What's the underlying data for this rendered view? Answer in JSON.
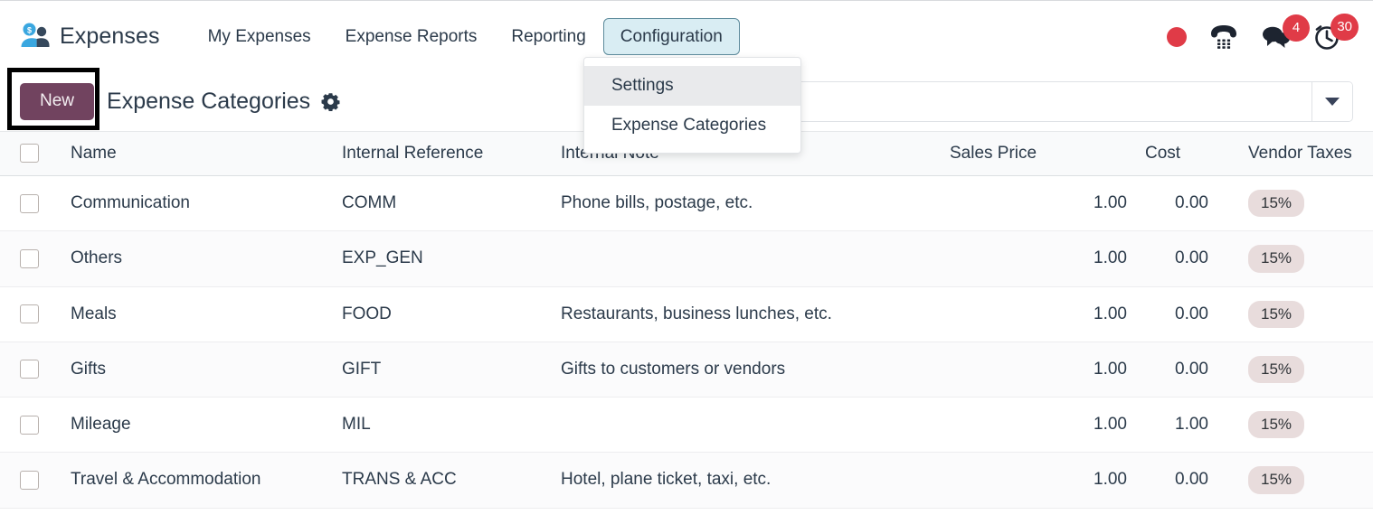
{
  "app": {
    "brand_name": "Expenses",
    "logo_icon": "expenses-people-dollar-icon"
  },
  "navbar": {
    "items": [
      {
        "label": "My Expenses",
        "active": false
      },
      {
        "label": "Expense Reports",
        "active": false
      },
      {
        "label": "Reporting",
        "active": false
      },
      {
        "label": "Configuration",
        "active": true
      }
    ],
    "systray": [
      {
        "name": "recording-indicator",
        "icon": "red-dot-icon",
        "badge": ""
      },
      {
        "name": "voip-phone",
        "icon": "phone-dialpad-icon",
        "badge": ""
      },
      {
        "name": "messaging",
        "icon": "chat-bubbles-icon",
        "badge": "4"
      },
      {
        "name": "activities",
        "icon": "clock-activity-icon",
        "badge": "30"
      }
    ]
  },
  "dropdown": {
    "open": true,
    "items": [
      {
        "label": "Settings",
        "hovered": true
      },
      {
        "label": "Expense Categories",
        "hovered": false
      }
    ]
  },
  "control_panel": {
    "new_button_label": "New",
    "page_title": "Expense Categories",
    "gear_icon": "gear-icon",
    "search_value": "",
    "search_placeholder": "",
    "search_toggle_icon": "chevron-down-icon"
  },
  "table": {
    "columns": [
      {
        "key": "name",
        "label": "Name"
      },
      {
        "key": "ref",
        "label": "Internal Reference"
      },
      {
        "key": "note",
        "label": "Internal Note"
      },
      {
        "key": "price",
        "label": "Sales Price"
      },
      {
        "key": "cost",
        "label": "Cost"
      },
      {
        "key": "tax",
        "label": "Vendor Taxes"
      }
    ],
    "rows": [
      {
        "name": "Communication",
        "ref": "COMM",
        "note": "Phone bills, postage, etc.",
        "price": "1.00",
        "cost": "0.00",
        "tax": "15%"
      },
      {
        "name": "Others",
        "ref": "EXP_GEN",
        "note": "",
        "price": "1.00",
        "cost": "0.00",
        "tax": "15%"
      },
      {
        "name": "Meals",
        "ref": "FOOD",
        "note": "Restaurants, business lunches, etc.",
        "price": "1.00",
        "cost": "0.00",
        "tax": "15%"
      },
      {
        "name": "Gifts",
        "ref": "GIFT",
        "note": "Gifts to customers or vendors",
        "price": "1.00",
        "cost": "0.00",
        "tax": "15%"
      },
      {
        "name": "Mileage",
        "ref": "MIL",
        "note": "",
        "price": "1.00",
        "cost": "1.00",
        "tax": "15%"
      },
      {
        "name": "Travel & Accommodation",
        "ref": "TRANS & ACC",
        "note": "Hotel, plane ticket, taxi, etc.",
        "price": "1.00",
        "cost": "0.00",
        "tax": "15%"
      }
    ]
  },
  "colors": {
    "new_button": "#71435f",
    "active_tab_bg": "#d9edf3",
    "active_tab_border": "#5d8b9c",
    "badge_red": "#e03b47",
    "tax_pill_bg": "#e8dcdc",
    "text": "#2b3a4a",
    "annotation_box": "#000000"
  },
  "annotation": {
    "target": "new-button",
    "shape": "rectangle"
  }
}
